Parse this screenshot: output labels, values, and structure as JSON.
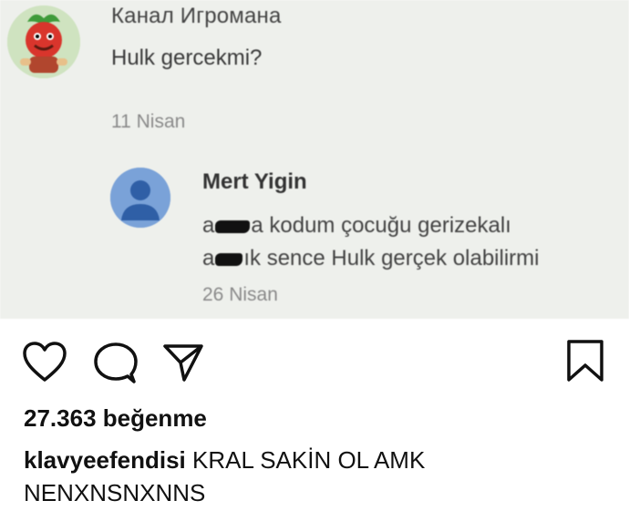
{
  "embedded": {
    "channel_name": "Канал Игромана",
    "channel_comment": "Hulk gercekmi?",
    "channel_date": "11 Nisan",
    "reply_name": "Mert Yigin",
    "reply_line1_suffix": "a kodum çocuğu gerizekalı",
    "reply_line1_prefix": "a",
    "reply_line2_prefix": "a",
    "reply_line2_suffix": "ık sence Hulk gerçek olabilirmi",
    "reply_date": "26 Nisan"
  },
  "actions": {
    "like_icon": "heart-icon",
    "comment_icon": "comment-icon",
    "share_icon": "share-icon",
    "save_icon": "bookmark-icon"
  },
  "post": {
    "likes": "27.363 beğenme",
    "username": "klavyeefendisi",
    "caption_text": "KRAL SAKİN OL AMK NENXNSNXNNS"
  },
  "colors": {
    "screenshot_bg": "#eef0ec",
    "avatar_blue": "#7aa2d8",
    "text_dark": "#111111"
  }
}
